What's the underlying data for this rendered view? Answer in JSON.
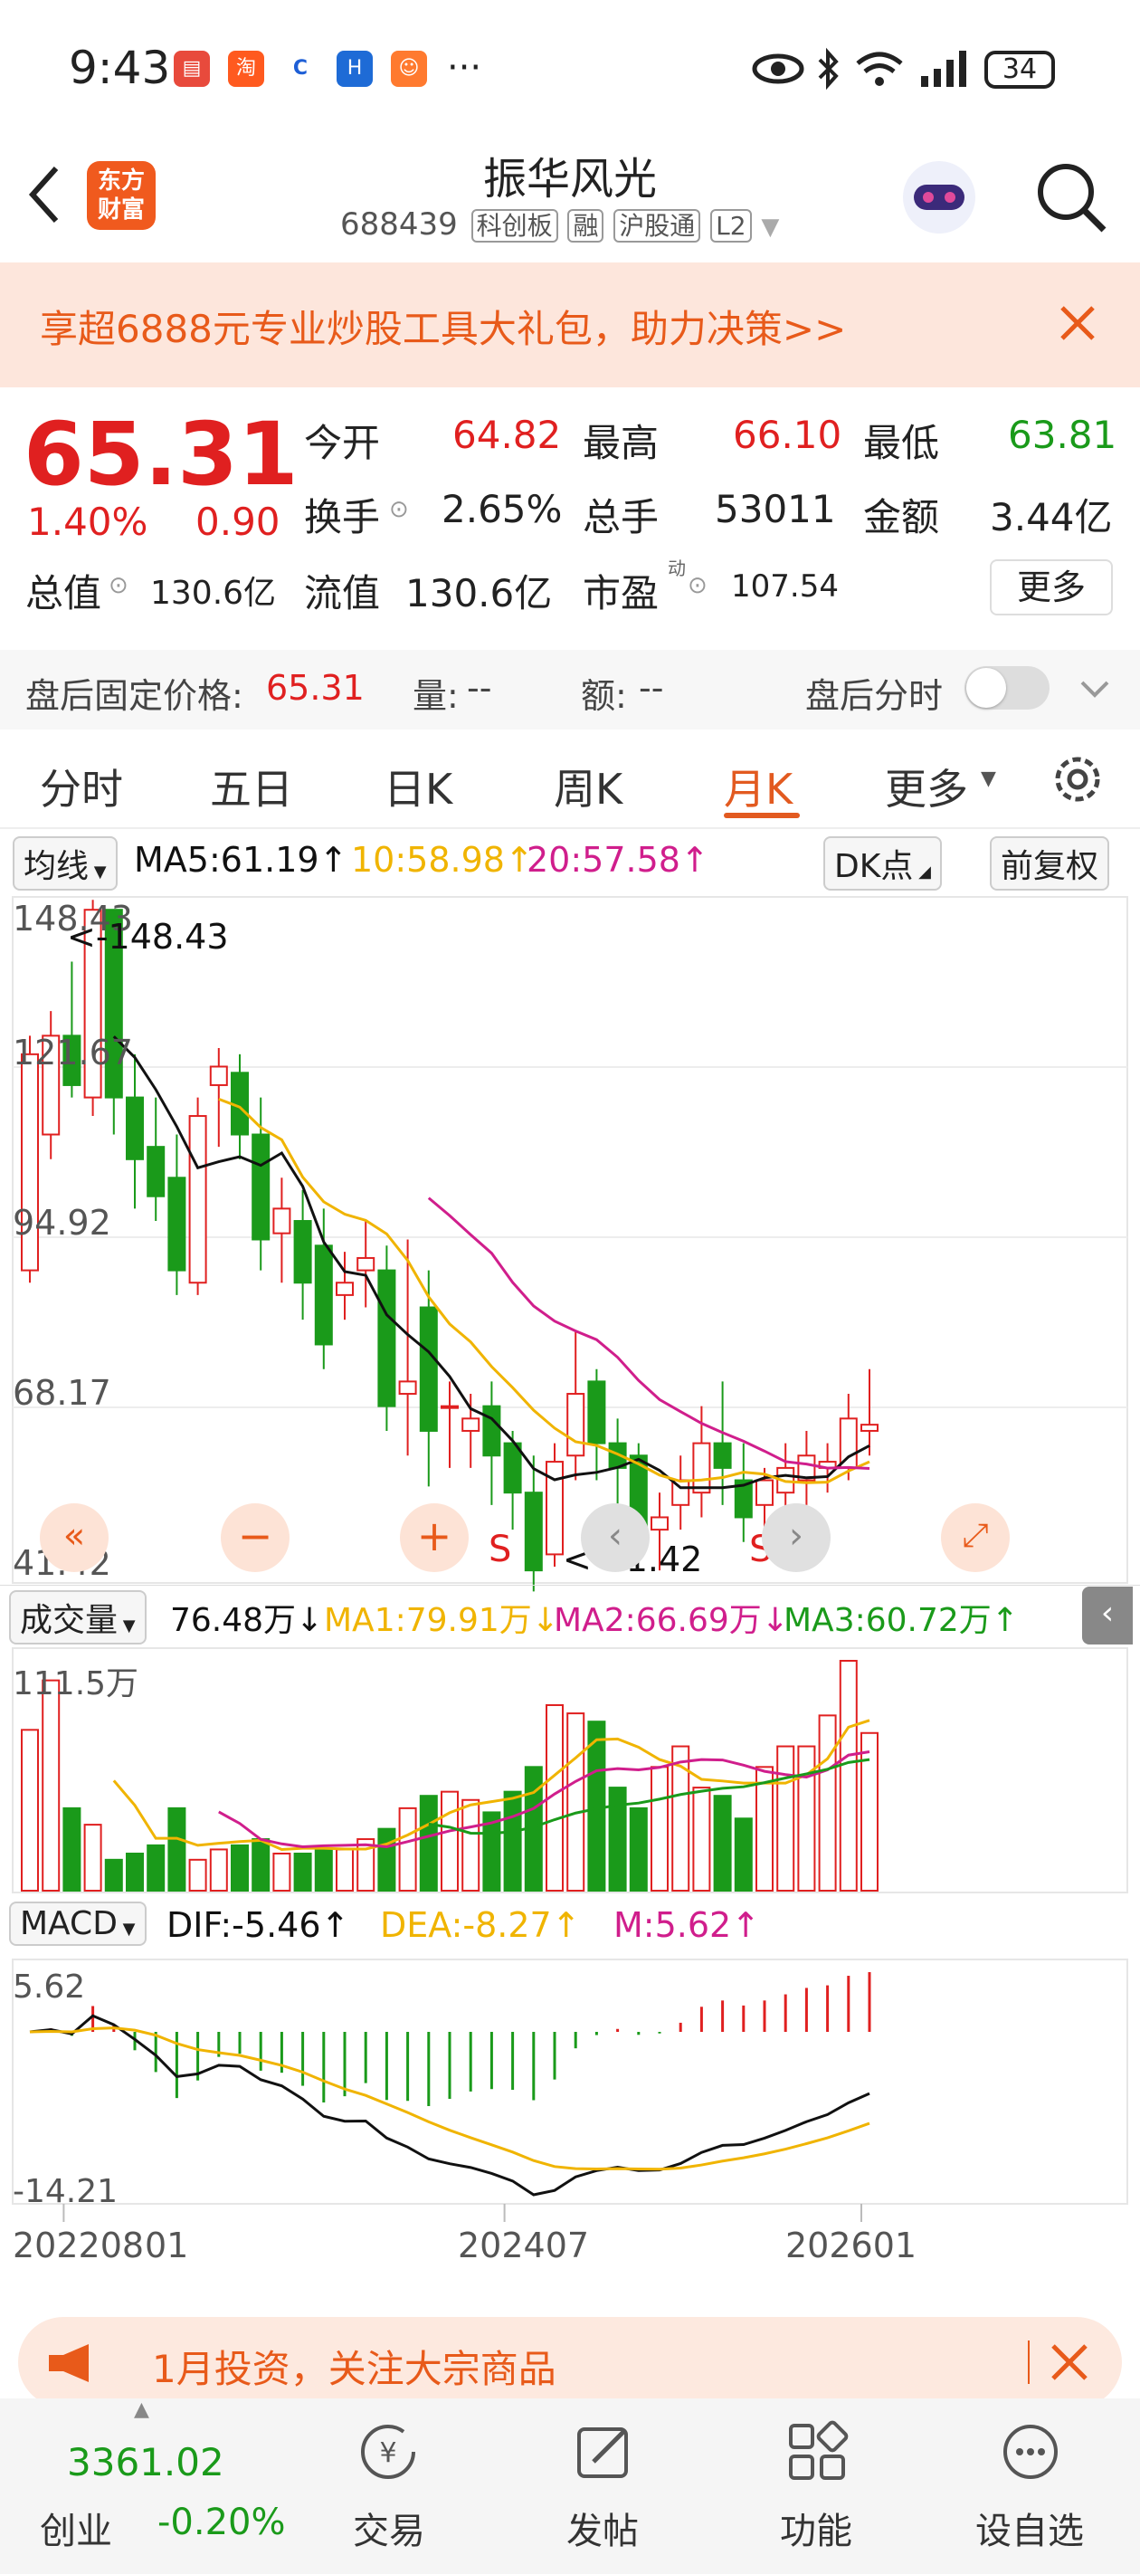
{
  "status": {
    "time": "9:43",
    "battery": "34",
    "icons": [
      "app-icon-red",
      "app-icon-taobao",
      "app-icon-blue-c",
      "app-icon-blue-h",
      "app-icon-orange",
      "more-dots",
      "eye-icon",
      "bluetooth-icon",
      "wifi-icon",
      "signal-icon",
      "battery-icon"
    ]
  },
  "nav": {
    "logo": "东方\n财富",
    "title": "振华风光",
    "code": "688439",
    "tags": [
      "科创板",
      "融",
      "沪股通",
      "L2"
    ]
  },
  "banner": {
    "text": "享超6888元专业炒股工具大礼包，助力决策>>"
  },
  "quote": {
    "price": "65.31",
    "pct": "1.40%",
    "chg": "0.90",
    "open_label": "今开",
    "open": "64.82",
    "high_label": "最高",
    "high": "66.10",
    "low_label": "最低",
    "low": "63.81",
    "turnover_label": "换手",
    "turnover": "2.65%",
    "vol_label": "总手",
    "vol": "53011",
    "amount_label": "金额",
    "amount": "3.44亿",
    "mcap_label": "总值",
    "mcap": "130.6亿",
    "float_label": "流值",
    "float": "130.6亿",
    "pe_label": "市盈",
    "pe_sup": "动",
    "pe": "107.54",
    "more": "更多"
  },
  "afterhours": {
    "label": "盘后固定价格:",
    "price": "65.31",
    "vol_label": "量:",
    "vol": "--",
    "amt_label": "额:",
    "amt": "--",
    "timeshare_label": "盘后分时"
  },
  "tabs": [
    "分时",
    "五日",
    "日K",
    "周K",
    "月K",
    "更多"
  ],
  "indicator": {
    "ma_selector": "均线",
    "ma5": "MA5:61.19↑",
    "ma10": "10:58.98↑",
    "ma20": "20:57.58↑",
    "dk": "DK点",
    "adjust": "前复权"
  },
  "price_axis": {
    "top": "148.43",
    "l2": "121.67",
    "l3": "94.92",
    "l4": "68.17",
    "bottom": "41.42",
    "max_mark": "<-148.43",
    "min_mark": "<-41.42"
  },
  "vol_ind": {
    "selector": "成交量",
    "value": "76.48万↓",
    "ma1": "MA1:79.91万↓",
    "ma2": "MA2:66.69万↓",
    "ma3": "MA3:60.72万↑",
    "axis_top": "111.5万"
  },
  "macd": {
    "selector": "MACD",
    "dif": "DIF:-5.46↑",
    "dea": "DEA:-8.27↑",
    "m": "M:5.62↑",
    "axis_top": "5.62",
    "axis_bottom": "-14.21"
  },
  "xaxis": [
    "202208",
    "01",
    "202407",
    "202601"
  ],
  "promo": {
    "text": "1月投资，关注大宗商品"
  },
  "bottom": {
    "index_value": "3361.02",
    "index_name": "创业",
    "index_pct": "-0.20%",
    "items": [
      "交易",
      "发帖",
      "功能",
      "设自选"
    ]
  },
  "colors": {
    "up": "#e02020",
    "down": "#1a9a1a",
    "accent": "#e25a20",
    "ma5": "#111111",
    "ma10": "#f0b400",
    "ma20": "#d01e8c"
  },
  "chart_data": {
    "type": "candlestick",
    "period": "monthly",
    "ylim": [
      41.42,
      148.43
    ],
    "candles": [
      [
        90,
        125,
        88,
        128
      ],
      [
        112,
        128,
        108,
        132
      ],
      [
        128,
        120,
        118,
        140
      ],
      [
        118,
        148.4,
        115,
        150
      ],
      [
        148.4,
        118,
        112,
        148.43
      ],
      [
        118,
        108,
        100,
        125
      ],
      [
        110,
        102,
        98,
        118
      ],
      [
        105,
        90,
        86,
        112
      ],
      [
        88,
        115,
        86,
        118
      ],
      [
        120,
        123,
        110,
        126
      ],
      [
        122,
        112,
        108,
        125
      ],
      [
        112,
        95,
        90,
        118
      ],
      [
        96,
        100,
        88,
        105
      ],
      [
        98,
        88,
        82,
        103
      ],
      [
        94,
        78,
        74,
        100
      ],
      [
        86,
        88,
        82,
        93
      ],
      [
        90,
        92,
        84,
        98
      ],
      [
        90,
        68,
        64,
        94
      ],
      [
        70,
        72,
        60,
        95
      ],
      [
        84,
        64,
        55,
        90
      ],
      [
        68,
        68,
        58,
        72
      ],
      [
        64,
        66,
        58,
        70
      ],
      [
        68,
        60,
        52,
        72
      ],
      [
        62,
        54,
        48,
        64
      ],
      [
        54,
        41.4,
        38,
        60
      ],
      [
        44,
        59,
        42,
        62
      ],
      [
        60,
        70,
        56,
        80
      ],
      [
        72,
        62,
        56,
        74
      ],
      [
        62,
        58,
        52,
        66
      ],
      [
        60,
        48,
        44,
        62
      ],
      [
        48,
        50,
        41.4,
        54
      ],
      [
        52,
        56,
        48,
        60
      ],
      [
        54,
        62,
        50,
        68
      ],
      [
        62,
        58,
        52,
        72
      ],
      [
        56,
        50,
        46,
        62
      ],
      [
        52,
        56,
        48,
        58
      ],
      [
        54,
        58,
        50,
        62
      ],
      [
        56,
        60,
        52,
        64
      ],
      [
        58,
        59,
        54,
        62
      ],
      [
        58,
        66,
        56,
        70
      ],
      [
        64,
        65,
        60,
        74
      ]
    ],
    "volume": [
      78,
      102,
      40,
      32,
      15,
      18,
      22,
      40,
      15,
      20,
      22,
      25,
      18,
      18,
      20,
      20,
      25,
      30,
      40,
      46,
      48,
      44,
      38,
      48,
      60,
      90,
      86,
      82,
      50,
      40,
      60,
      70,
      50,
      46,
      35,
      60,
      70,
      70,
      85,
      111.5,
      76.48
    ]
  }
}
